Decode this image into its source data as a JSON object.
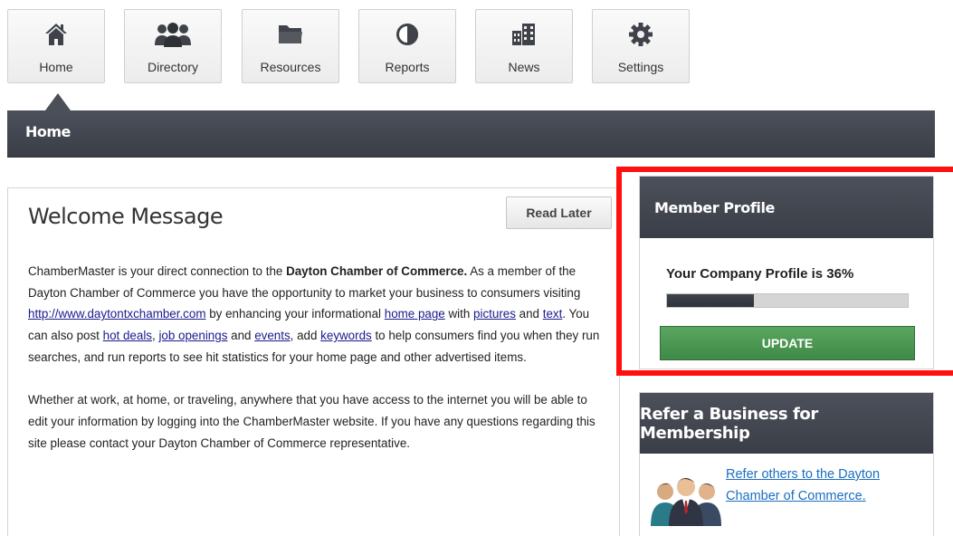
{
  "nav": {
    "tiles": [
      {
        "label": "Home",
        "icon": "home-icon"
      },
      {
        "label": "Directory",
        "icon": "people-icon"
      },
      {
        "label": "Resources",
        "icon": "folder-icon"
      },
      {
        "label": "Reports",
        "icon": "pie-chart-icon"
      },
      {
        "label": "News",
        "icon": "buildings-icon"
      },
      {
        "label": "Settings",
        "icon": "gear-icon"
      }
    ],
    "active": "Home"
  },
  "header": {
    "title": "Home"
  },
  "welcome": {
    "title": "Welcome Message",
    "read_later_label": "Read Later",
    "p1": {
      "t1": "ChamberMaster is your direct connection to the ",
      "org_bold": "Dayton Chamber of Commerce.",
      "t2": " As a member of the Dayton Chamber of Commerce you have the opportunity to market your business to consumers visiting ",
      "link_url": "http://www.daytontxchamber.com",
      "t3": " by enhancing your informational ",
      "link_home": "home page",
      "t4": " with ",
      "link_pictures": "pictures",
      "t5": " and ",
      "link_text": "text",
      "t6": ".  You can also post ",
      "link_hot": "hot deals",
      "t7": ", ",
      "link_jobs": "job openings",
      "t8": " and ",
      "link_events": "events",
      "t9": ", add ",
      "link_keywords": "keywords",
      "t10": " to help consumers find you when they run searches, and run reports to see hit statistics for your home page and other advertised items."
    },
    "p2": "Whether at work, at home, or traveling, anywhere that you have access to the internet you will be able to edit your information by logging into the ChamberMaster website.  If you have any questions regarding this site please contact your Dayton Chamber of Commerce representative."
  },
  "member_profile": {
    "title": "Member Profile",
    "completion_text": "Your Company Profile is 36%",
    "progress_fraction": 0.36,
    "update_label": "UPDATE",
    "highlight_color": "#ff0f0f"
  },
  "refer": {
    "title": "Refer a Business for Membership",
    "text": "Refer others to the Dayton Chamber of Commerce.",
    "icon": "business-people-icon"
  },
  "colors": {
    "header_bg": "#3f444d",
    "update_green": "#4a9a51",
    "link_blue": "#1a6ec2"
  }
}
